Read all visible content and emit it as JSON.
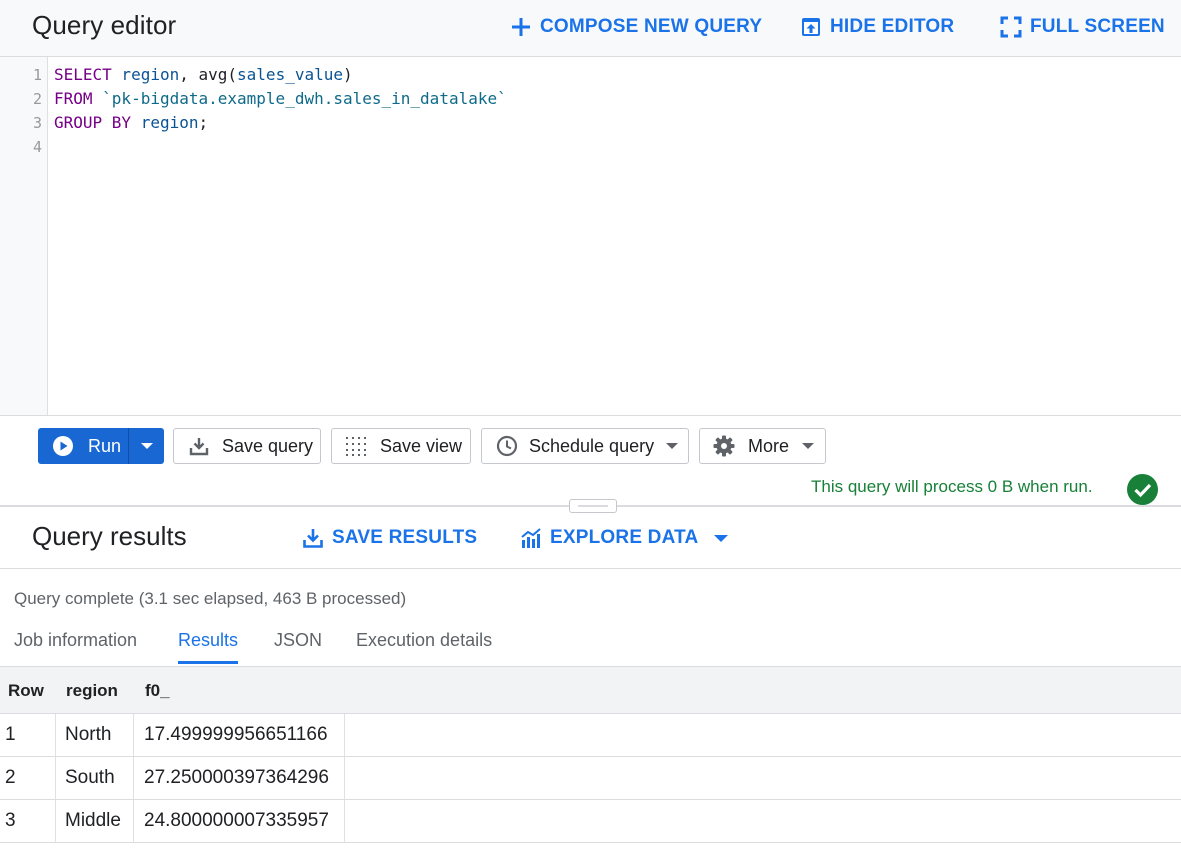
{
  "editor": {
    "title": "Query editor",
    "actions": {
      "compose": "COMPOSE NEW QUERY",
      "hide": "HIDE EDITOR",
      "fullscreen": "FULL SCREEN"
    },
    "line_numbers": [
      "1",
      "2",
      "3",
      "4"
    ],
    "code": {
      "l1": [
        "SELECT",
        " region",
        ", avg(",
        "sales_value",
        ")"
      ],
      "l2": [
        "FROM",
        " `pk-bigdata.example_dwh.sales_in_datalake`"
      ],
      "l3": [
        "GROUP BY",
        " region",
        ";"
      ]
    }
  },
  "toolbar": {
    "run": "Run",
    "save_query": "Save query",
    "save_view": "Save view",
    "schedule_query": "Schedule query",
    "more": "More"
  },
  "validator": {
    "message": "This query will process 0 B when run."
  },
  "results": {
    "title": "Query results",
    "save_results": "SAVE RESULTS",
    "explore_data": "EXPLORE DATA",
    "status": "Query complete (3.1 sec elapsed, 463 B processed)",
    "tabs": [
      "Job information",
      "Results",
      "JSON",
      "Execution details"
    ],
    "active_tab": "Results",
    "columns": [
      "Row",
      "region",
      "f0_"
    ],
    "rows": [
      [
        "1",
        "North",
        "17.499999956651166"
      ],
      [
        "2",
        "South",
        "27.250000397364296"
      ],
      [
        "3",
        "Middle",
        "24.800000007335957"
      ]
    ]
  },
  "colors": {
    "accent": "#1a73e8",
    "run_button": "#1967d2",
    "success": "#188038",
    "keyword": "#770088"
  },
  "icons": [
    "add-icon",
    "hide-editor-icon",
    "fullscreen-icon",
    "play-icon",
    "dropdown-arrow-icon",
    "download-icon",
    "grid-view-icon",
    "clock-icon",
    "gear-icon",
    "check-circle-icon",
    "explore-chart-icon"
  ]
}
